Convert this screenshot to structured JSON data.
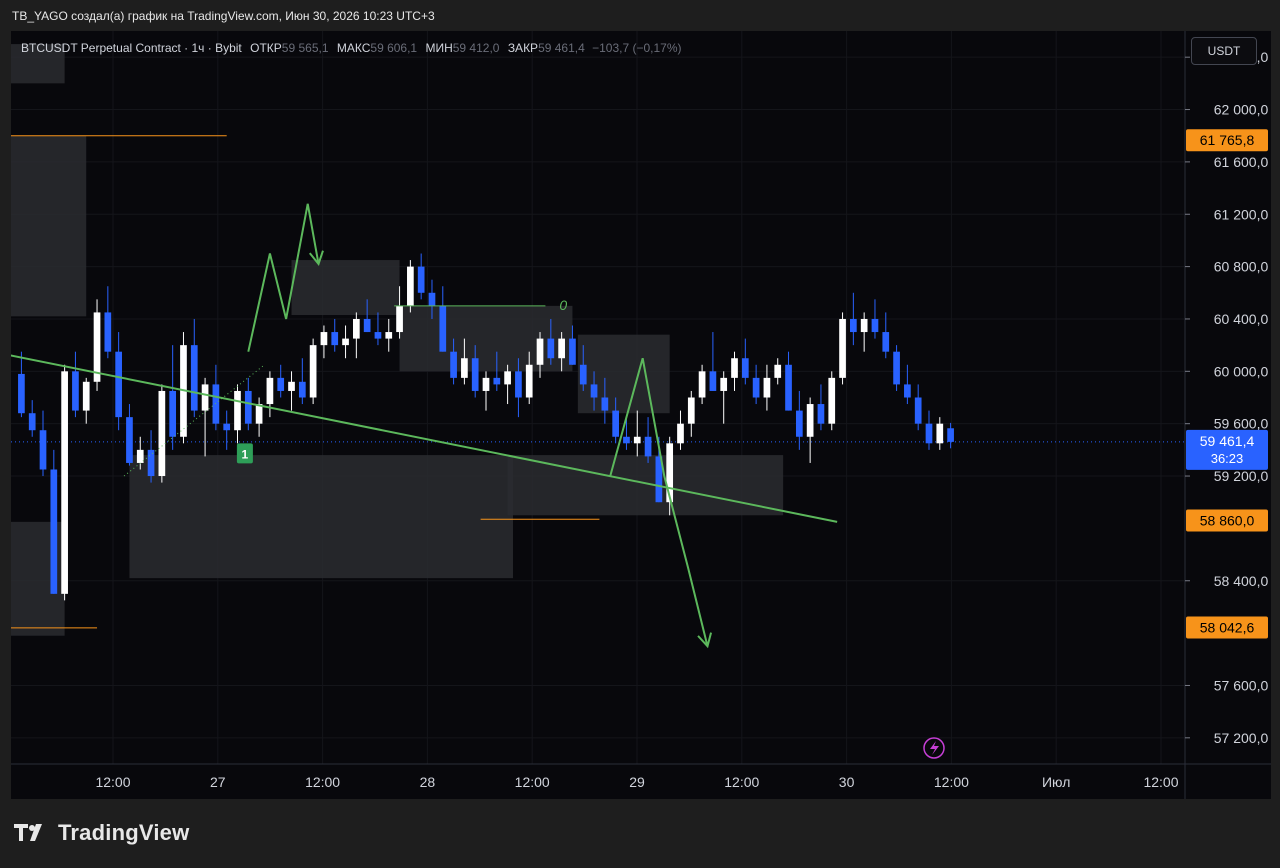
{
  "header": {
    "title": "TB_YAGO создал(а) график на TradingView.com, Июн 30, 2026 10:23 UTC+3"
  },
  "legend": {
    "symbol": "BTCUSDT Perpetual Contract · 1ч · Bybit",
    "open_label": "ОТКР",
    "open": "59 565,1",
    "high_label": "МАКС",
    "high": "59 606,1",
    "low_label": "МИН",
    "low": "59 412,0",
    "close_label": "ЗАКР",
    "close": "59 461,4",
    "change": "−103,7 (−0,17%)"
  },
  "currency": "USDT",
  "footer": {
    "brand": "TradingView"
  },
  "colors": {
    "up": "#ffffff",
    "down": "#2962ff",
    "drawing": "#5cb85c",
    "level": "#f7931a",
    "zone": "#2a2b30",
    "tag": "#f7931a",
    "price_tag": "#2962ff"
  },
  "chart_data": {
    "type": "candlestick",
    "ylim": [
      57000,
      62600
    ],
    "y_ticks": [
      {
        "v": 62400,
        "t": "62 400,0"
      },
      {
        "v": 62000,
        "t": "62 000,0"
      },
      {
        "v": 61600,
        "t": "61 600,0"
      },
      {
        "v": 61200,
        "t": "61 200,0"
      },
      {
        "v": 60800,
        "t": "60 800,0"
      },
      {
        "v": 60400,
        "t": "60 400,0"
      },
      {
        "v": 60000,
        "t": "60 000,0"
      },
      {
        "v": 59600,
        "t": "59 600,0"
      },
      {
        "v": 59200,
        "t": "59 200,0"
      },
      {
        "v": 58400,
        "t": "58 400,0"
      },
      {
        "v": 57600,
        "t": "57 600,0"
      },
      {
        "v": 57200,
        "t": "57 200,0"
      }
    ],
    "x_labels": [
      "12:00",
      "27",
      "12:00",
      "28",
      "12:00",
      "29",
      "12:00",
      "30",
      "12:00",
      "Июл",
      "12:00"
    ],
    "price_tags": [
      {
        "v": 61765.8,
        "t": "61 765,8",
        "kind": "level"
      },
      {
        "v": 58860.0,
        "t": "58 860,0",
        "kind": "level"
      },
      {
        "v": 58042.6,
        "t": "58 042,6",
        "kind": "level"
      },
      {
        "v": 59461.4,
        "t": "59 461,4",
        "sub": "36:23",
        "kind": "last"
      }
    ],
    "candles": [
      [
        59980,
        60150,
        59650,
        59680
      ],
      [
        59680,
        59780,
        59500,
        59550
      ],
      [
        59550,
        59700,
        59200,
        59250
      ],
      [
        59250,
        59400,
        58300,
        58300
      ],
      [
        58300,
        60050,
        58250,
        60000
      ],
      [
        60000,
        60150,
        59650,
        59700
      ],
      [
        59700,
        59950,
        59600,
        59920
      ],
      [
        59920,
        60550,
        59850,
        60450
      ],
      [
        60450,
        60650,
        60100,
        60150
      ],
      [
        60150,
        60300,
        59550,
        59650
      ],
      [
        59650,
        59750,
        59280,
        59300
      ],
      [
        59300,
        59500,
        59250,
        59400
      ],
      [
        59400,
        59550,
        59150,
        59200
      ],
      [
        59200,
        59900,
        59150,
        59850
      ],
      [
        59850,
        60200,
        59400,
        59500
      ],
      [
        59500,
        60300,
        59450,
        60200
      ],
      [
        60200,
        60400,
        59650,
        59700
      ],
      [
        59700,
        59950,
        59350,
        59900
      ],
      [
        59900,
        60050,
        59550,
        59600
      ],
      [
        59600,
        59700,
        59400,
        59550
      ],
      [
        59550,
        59900,
        59450,
        59850
      ],
      [
        59850,
        59950,
        59550,
        59600
      ],
      [
        59600,
        59800,
        59500,
        59750
      ],
      [
        59750,
        60000,
        59650,
        59950
      ],
      [
        59950,
        60050,
        59800,
        59850
      ],
      [
        59850,
        60000,
        59700,
        59920
      ],
      [
        59920,
        60100,
        59750,
        59800
      ],
      [
        59800,
        60250,
        59750,
        60200
      ],
      [
        60200,
        60350,
        60100,
        60300
      ],
      [
        60300,
        60400,
        60150,
        60200
      ],
      [
        60200,
        60350,
        60100,
        60250
      ],
      [
        60250,
        60450,
        60100,
        60400
      ],
      [
        60400,
        60550,
        60300,
        60300
      ],
      [
        60300,
        60450,
        60200,
        60250
      ],
      [
        60250,
        60400,
        60150,
        60300
      ],
      [
        60300,
        60650,
        60250,
        60500
      ],
      [
        60500,
        60850,
        60450,
        60800
      ],
      [
        60800,
        60900,
        60550,
        60600
      ],
      [
        60600,
        60700,
        60400,
        60500
      ],
      [
        60500,
        60650,
        60150,
        60150
      ],
      [
        60150,
        60250,
        59900,
        59950
      ],
      [
        59950,
        60250,
        59900,
        60100
      ],
      [
        60100,
        60200,
        59800,
        59850
      ],
      [
        59850,
        60000,
        59700,
        59950
      ],
      [
        59950,
        60150,
        59850,
        59900
      ],
      [
        59900,
        60050,
        59750,
        60000
      ],
      [
        60000,
        60100,
        59650,
        59800
      ],
      [
        59800,
        60150,
        59750,
        60050
      ],
      [
        60050,
        60300,
        59950,
        60250
      ],
      [
        60250,
        60400,
        60050,
        60100
      ],
      [
        60100,
        60300,
        60000,
        60250
      ],
      [
        60250,
        60350,
        60050,
        60050
      ],
      [
        60050,
        60200,
        59850,
        59900
      ],
      [
        59900,
        60000,
        59700,
        59800
      ],
      [
        59800,
        59950,
        59600,
        59700
      ],
      [
        59700,
        59800,
        59450,
        59500
      ],
      [
        59500,
        59650,
        59400,
        59450
      ],
      [
        59450,
        59700,
        59350,
        59500
      ],
      [
        59500,
        59650,
        59300,
        59350
      ],
      [
        59350,
        59500,
        59000,
        59000
      ],
      [
        59000,
        59500,
        58900,
        59450
      ],
      [
        59450,
        59700,
        59400,
        59600
      ],
      [
        59600,
        59850,
        59500,
        59800
      ],
      [
        59800,
        60050,
        59750,
        60000
      ],
      [
        60000,
        60300,
        59850,
        59850
      ],
      [
        59850,
        60000,
        59600,
        59950
      ],
      [
        59950,
        60150,
        59850,
        60100
      ],
      [
        60100,
        60250,
        59900,
        59950
      ],
      [
        59950,
        60050,
        59750,
        59800
      ],
      [
        59800,
        60050,
        59700,
        59950
      ],
      [
        59950,
        60100,
        59900,
        60050
      ],
      [
        60050,
        60150,
        59700,
        59700
      ],
      [
        59700,
        59850,
        59400,
        59500
      ],
      [
        59500,
        59800,
        59300,
        59750
      ],
      [
        59750,
        59900,
        59550,
        59600
      ],
      [
        59600,
        60000,
        59550,
        59950
      ],
      [
        59950,
        60450,
        59900,
        60400
      ],
      [
        60400,
        60600,
        60200,
        60300
      ],
      [
        60300,
        60450,
        60150,
        60400
      ],
      [
        60400,
        60550,
        60250,
        60300
      ],
      [
        60300,
        60450,
        60100,
        60150
      ],
      [
        60150,
        60200,
        59850,
        59900
      ],
      [
        59900,
        60050,
        59750,
        59800
      ],
      [
        59800,
        59900,
        59550,
        59600
      ],
      [
        59600,
        59700,
        59400,
        59450
      ],
      [
        59450,
        59650,
        59400,
        59600
      ],
      [
        59565,
        59606,
        59412,
        59461
      ]
    ],
    "zones": [
      {
        "i0": -1.0,
        "i1": 6.5,
        "y0": 61800,
        "y1": 60420
      },
      {
        "i0": 10.5,
        "i1": 46,
        "y0": 59360,
        "y1": 58420
      },
      {
        "i0": 25.5,
        "i1": 35.5,
        "y0": 60850,
        "y1": 60430
      },
      {
        "i0": 35.5,
        "i1": 51.5,
        "y0": 60500,
        "y1": 60000
      },
      {
        "i0": 45.5,
        "i1": 71,
        "y0": 59360,
        "y1": 58900
      },
      {
        "i0": 52,
        "i1": 60.5,
        "y0": 60280,
        "y1": 59680
      },
      {
        "i0": -1.0,
        "i1": 4.5,
        "y0": 58850,
        "y1": 57980
      },
      {
        "i0": -1.0,
        "i1": 4.5,
        "y0": 62500,
        "y1": 62200
      }
    ],
    "levels": [
      {
        "i0": -1.0,
        "i1": 19.5,
        "y": 61800
      },
      {
        "i0": -1.0,
        "i1": 7.5,
        "y": 58040
      },
      {
        "i0": 43,
        "i1": 54,
        "y": 58870
      }
    ],
    "trendline": {
      "i0": -1.0,
      "y0": 60130,
      "i1": 76,
      "y1": 58850
    },
    "hline_green": {
      "i0": 35,
      "i1": 49,
      "y": 60500,
      "label": "0"
    },
    "zigzag1": [
      [
        21.5,
        60150
      ],
      [
        23.5,
        60900
      ],
      [
        25,
        60400
      ],
      [
        27,
        61280
      ],
      [
        28,
        60820
      ]
    ],
    "zigzag2": [
      [
        55,
        59200
      ],
      [
        58,
        60100
      ],
      [
        60,
        59200
      ],
      [
        62.2,
        58500
      ],
      [
        64,
        57900
      ]
    ],
    "dotted": {
      "i0": 10,
      "y0": 59200,
      "i1": 23,
      "y1": 60050
    },
    "signal_label": "1"
  }
}
